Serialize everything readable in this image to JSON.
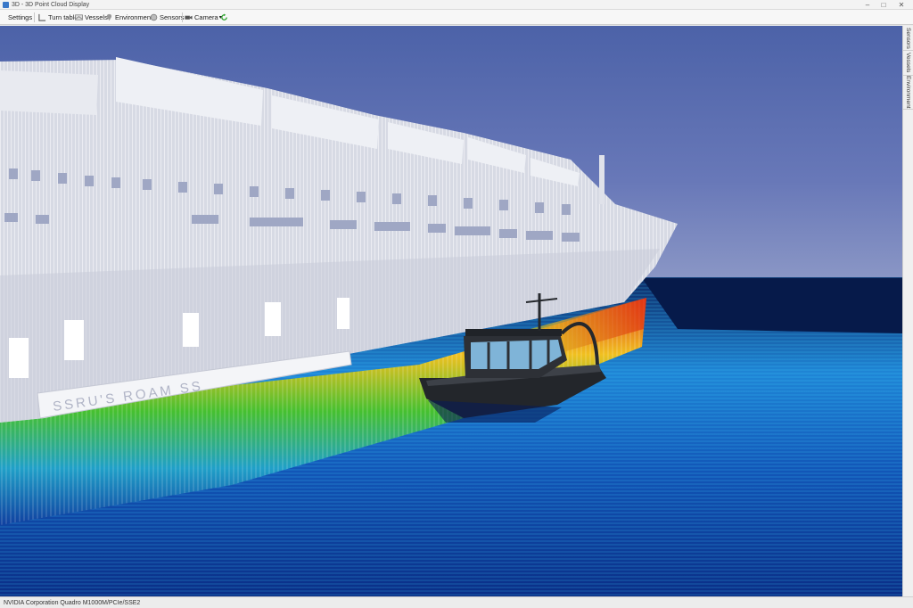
{
  "window": {
    "title": "3D - 3D Point Cloud Display",
    "minimize": "–",
    "maximize": "□",
    "close": "✕"
  },
  "toolbar": {
    "settings": "Settings",
    "turntable": "Turn table",
    "vessels": "Vessels",
    "environment": "Environment",
    "sensors": "Sensors",
    "camera": "Camera",
    "camera_caret": "▾",
    "refresh_icon": "refresh-icon"
  },
  "sidebar": {
    "tabs": [
      {
        "label": "Sensors"
      },
      {
        "label": "Vessels"
      },
      {
        "label": "Environment"
      }
    ]
  },
  "viewport": {
    "hull_text": "SSRU'S ROAM SS",
    "colors": {
      "sky": "#5a6fb0",
      "seabed_deep": "#0a2d7a",
      "seabed_shallow": "#1ea0e0",
      "hull_white": "#f0f0f5",
      "boat": "#2a2d32"
    }
  },
  "status": {
    "text": "NVIDIA Corporation Quadro M1000M/PCIe/SSE2"
  }
}
